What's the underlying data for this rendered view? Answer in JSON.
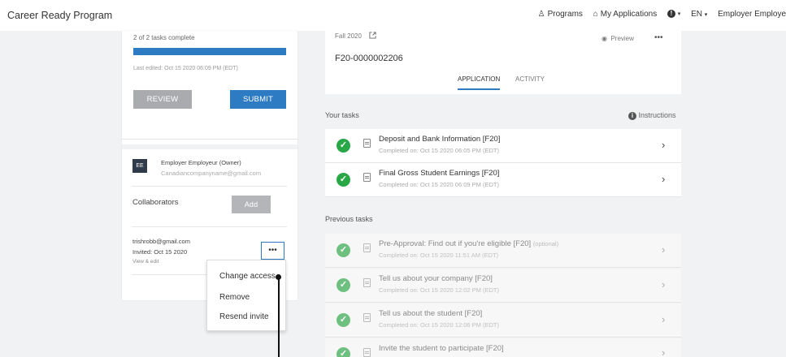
{
  "header": {
    "app_title": "Career Ready Program",
    "programs": "Programs",
    "my_applications": "My Applications",
    "language": "EN",
    "user": "Employer Employe"
  },
  "sidebar": {
    "progress_text": "2 of 2 tasks complete",
    "progress_fraction": 1.0,
    "last_edited": "Last edited: Oct 15 2020 06:09 PM (EDT)",
    "review_label": "REVIEW",
    "submit_label": "SUBMIT",
    "owner": {
      "initials": "EE",
      "name": "Employer Employeur (Owner)",
      "email": "Canadiancompanyname@gmail.com"
    },
    "collaborators_label": "Collaborators",
    "add_label": "Add",
    "collaborator": {
      "email": "trishrobb@gmail.com",
      "invited": "Invited: Oct 15 2020",
      "access": "View & edit",
      "more": "•••"
    },
    "menu": {
      "items": [
        "Change access",
        "Remove",
        "Resend invite"
      ]
    }
  },
  "application": {
    "term": "Fall 2020",
    "preview": "Preview",
    "more": "•••",
    "id": "F20-0000002206",
    "tabs": [
      "APPLICATION",
      "ACTIVITY"
    ],
    "active_tab": "APPLICATION"
  },
  "your_tasks": {
    "label": "Your tasks",
    "instructions": "Instructions",
    "items": [
      {
        "title": "Deposit and Bank Information [F20]",
        "sub": "Completed on: Oct 15 2020 06:05 PM (EDT)"
      },
      {
        "title": "Final Gross Student Earnings [F20]",
        "sub": "Completed on: Oct 15 2020 06:09 PM (EDT)"
      }
    ]
  },
  "previous_tasks": {
    "label": "Previous tasks",
    "items": [
      {
        "title": "Pre-Approval: Find out if you're eligible [F20]",
        "optional": "(optional)",
        "sub": "Completed on: Oct 15 2020 11:51 AM (EDT)"
      },
      {
        "title": "Tell us about your company [F20]",
        "sub": "Completed on: Oct 15 2020 12:02 PM (EDT)"
      },
      {
        "title": "Tell us about the student [F20]",
        "sub": "Completed on: Oct 15 2020 12:06 PM (EDT)"
      },
      {
        "title": "Invite the student to participate [F20]",
        "sub": ""
      }
    ]
  },
  "colors": {
    "accent": "#2c7bc3",
    "success": "#27a745",
    "review_button": "#a9abae"
  }
}
